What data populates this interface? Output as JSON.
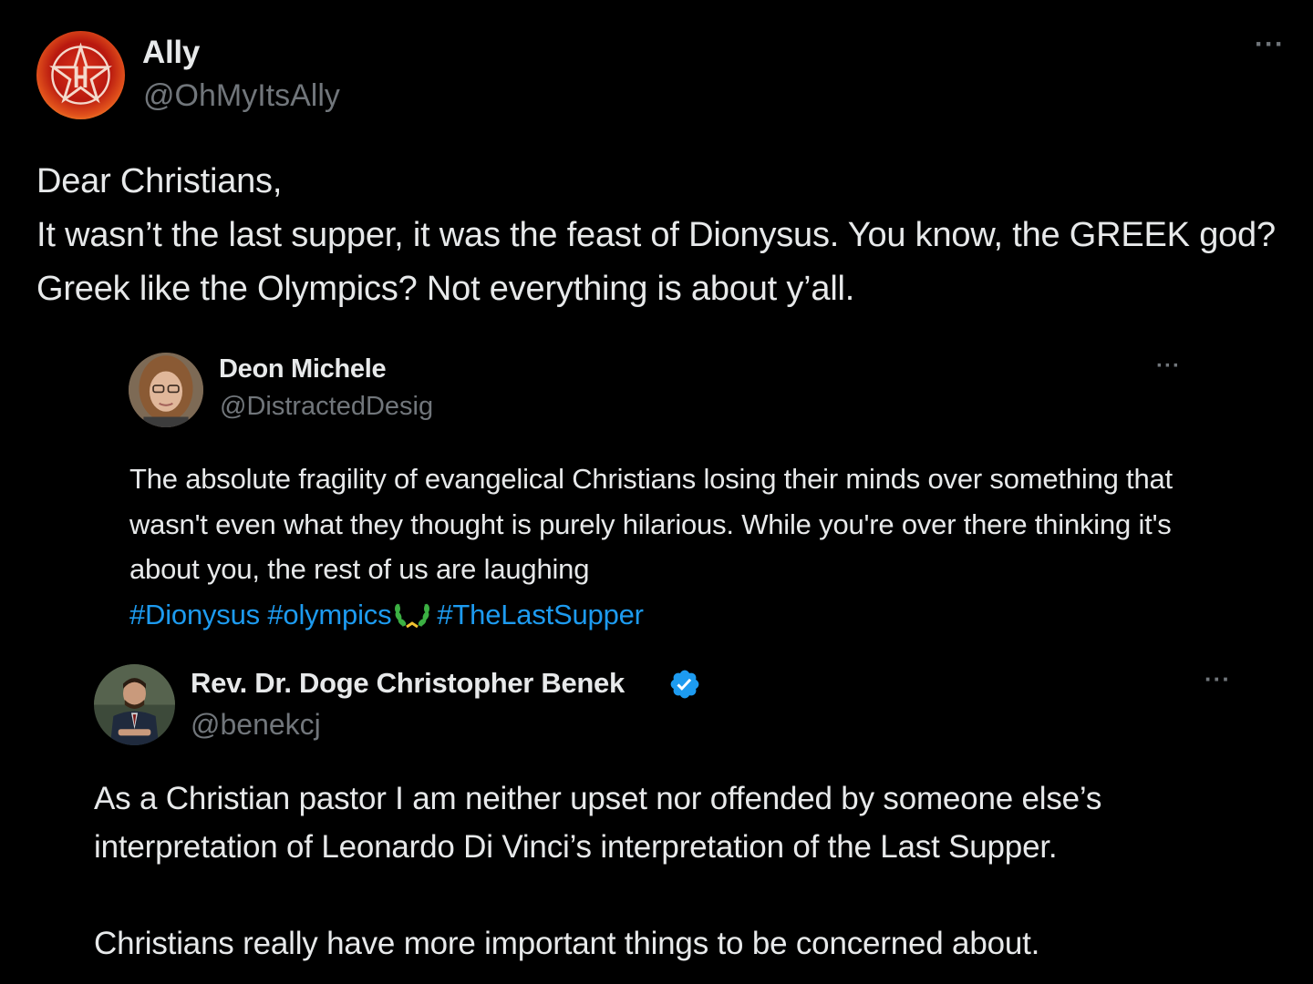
{
  "tweets": [
    {
      "author_name": "Ally",
      "author_handle": "@OhMyItsAlly",
      "avatar_icon": "houston-star-logo-icon",
      "more_label": "···",
      "text": "Dear Christians,\nIt wasn’t the last supper, it was the feast of Dionysus. You know, the GREEK god? Greek like the Olympics? Not everything is about y’all."
    },
    {
      "author_name": "Deon Michele",
      "author_handle": "@DistractedDesig",
      "avatar_icon": "user-photo-avatar",
      "more_label": "···",
      "text": "The absolute fragility of evangelical Christians losing their minds over something that wasn't even what they thought is purely hilarious. While you're over there thinking it's about you, the rest of us are laughing",
      "hashtags": [
        "#Dionysus",
        "#olympics",
        "#TheLastSupper"
      ],
      "emoji_icon": "laurel-wreath-icon"
    },
    {
      "author_name": "Rev. Dr. Doge Christopher Benek",
      "author_handle": "@benekcj",
      "avatar_icon": "user-photo-avatar",
      "verified": true,
      "verified_icon": "verified-badge-icon",
      "more_label": "···",
      "text": "As a Christian pastor I am neither upset nor offended by someone else’s interpretation of Leonardo Di Vinci’s interpretation of the Last Supper.\n\nChristians really have more important things to be concerned about."
    }
  ],
  "colors": {
    "background": "#000000",
    "text_primary": "#e7e9ea",
    "text_secondary": "#71767b",
    "link": "#1d9bf0",
    "verified": "#1d9bf0"
  }
}
